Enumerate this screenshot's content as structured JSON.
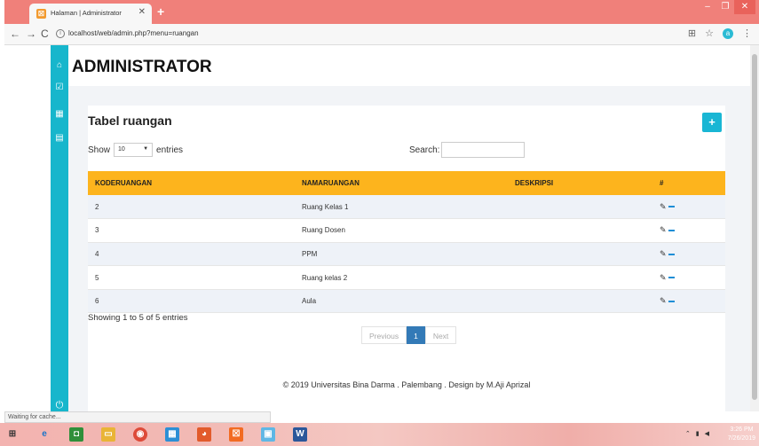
{
  "browser": {
    "tab_title": "Halaman | Administrator",
    "tab_favicon": "xampp-icon",
    "new_tab_label": "+",
    "url": "localhost/web/admin.php?menu=ruangan",
    "status_text": "Waiting for cache..."
  },
  "sidebar": {
    "icons": [
      "home-icon",
      "checkbox-icon",
      "table-icon",
      "document-icon"
    ],
    "bottom_icon": "power-icon"
  },
  "header": {
    "brand": "ADMINISTRATOR"
  },
  "panel": {
    "title": "Tabel ruangan",
    "add_button_label": "+",
    "show_label": "Show",
    "page_length": "10",
    "entries_label": "entries",
    "search_label": "Search:",
    "search_value": ""
  },
  "table": {
    "columns": [
      "KODERUANGAN",
      "NAMARUANGAN",
      "DESKRIPSI",
      "#"
    ],
    "rows": [
      {
        "kode": "2",
        "nama": "Ruang Kelas 1",
        "deskripsi": ""
      },
      {
        "kode": "3",
        "nama": "Ruang Dosen",
        "deskripsi": ""
      },
      {
        "kode": "4",
        "nama": "PPM",
        "deskripsi": ""
      },
      {
        "kode": "5",
        "nama": "Ruang kelas 2",
        "deskripsi": ""
      },
      {
        "kode": "6",
        "nama": "Aula",
        "deskripsi": ""
      }
    ],
    "info": "Showing 1 to 5 of 5 entries"
  },
  "pagination": {
    "previous": "Previous",
    "current_page": "1",
    "next": "Next"
  },
  "footer": {
    "text": "© 2019 Universitas Bina Darma . Palembang . Design by M.Aji Aprizal"
  },
  "taskbar": {
    "time": "3:26 PM",
    "date": "7/26/2019"
  },
  "colors": {
    "sidebar": "#17b6cc",
    "table_header": "#fdb41d",
    "add_button": "#19b6d4",
    "pager_active": "#337ab7",
    "titlebar": "#f0807a"
  }
}
